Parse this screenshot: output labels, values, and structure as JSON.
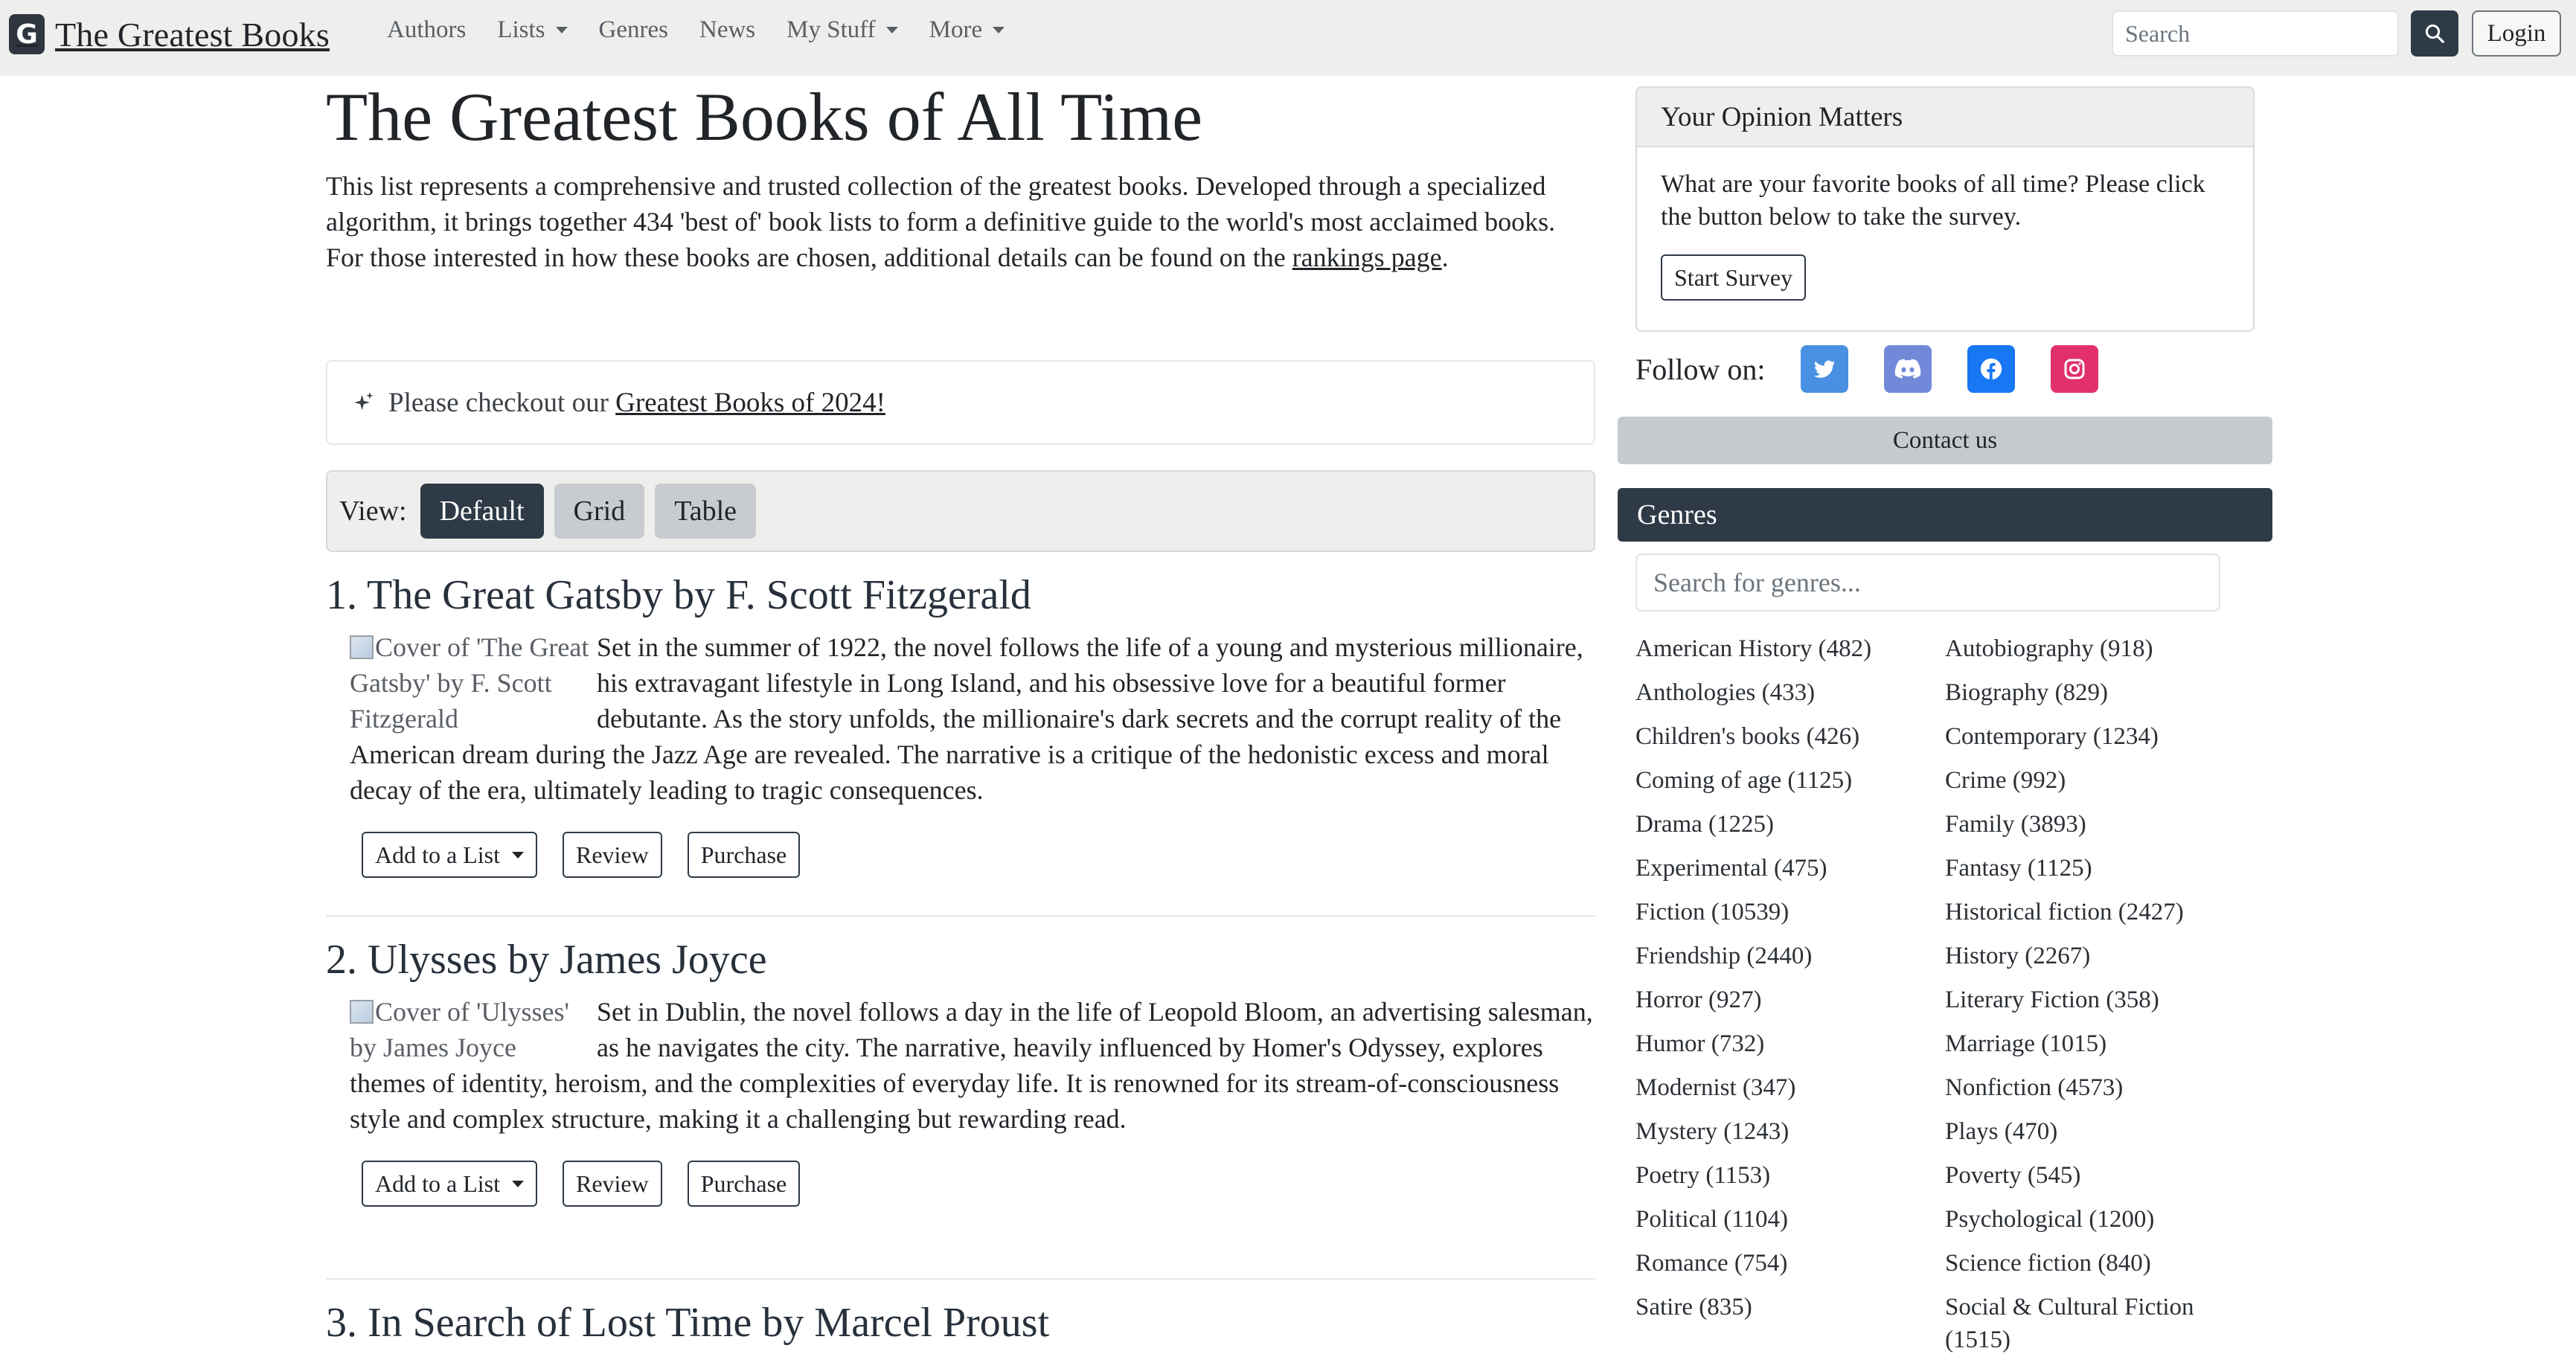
{
  "nav": {
    "brand": "The Greatest Books",
    "logo_letter": "G",
    "links": [
      {
        "label": "Authors",
        "dropdown": false
      },
      {
        "label": "Lists",
        "dropdown": true
      },
      {
        "label": "Genres",
        "dropdown": false
      },
      {
        "label": "News",
        "dropdown": false
      },
      {
        "label": "My Stuff",
        "dropdown": true
      },
      {
        "label": "More",
        "dropdown": true
      }
    ],
    "search_placeholder": "Search",
    "login_label": "Login"
  },
  "main": {
    "title": "The Greatest Books of All Time",
    "intro_text": "This list represents a comprehensive and trusted collection of the greatest books. Developed through a specialized algorithm, it brings together 434 'best of' book lists to form a definitive guide to the world's most acclaimed books. For those interested in how these books are chosen, additional details can be found on the ",
    "intro_link": "rankings page",
    "intro_end": ".",
    "notice_text": "Please checkout our ",
    "notice_link": "Greatest Books of 2024!",
    "view_label": "View:",
    "views": [
      "Default",
      "Grid",
      "Table"
    ],
    "active_view": "Default",
    "books": [
      {
        "title": "1. The Great Gatsby by F. Scott Fitzgerald",
        "cover_alt": "Cover of 'The Great Gatsby' by F. Scott Fitzgerald",
        "description": "Set in the summer of 1922, the novel follows the life of a young and mysterious millionaire, his extravagant lifestyle in Long Island, and his obsessive love for a beautiful former debutante. As the story unfolds, the millionaire's dark secrets and the corrupt reality of the American dream during the Jazz Age are revealed. The narrative is a critique of the hedonistic excess and moral decay of the era, ultimately leading to tragic consequences.",
        "actions": {
          "add": "Add to a List",
          "review": "Review",
          "purchase": "Purchase"
        }
      },
      {
        "title": "2. Ulysses by James Joyce",
        "cover_alt": "Cover of 'Ulysses' by James Joyce",
        "description": "Set in Dublin, the novel follows a day in the life of Leopold Bloom, an advertising salesman, as he navigates the city. The narrative, heavily influenced by Homer's Odyssey, explores themes of identity, heroism, and the complexities of everyday life. It is renowned for its stream-of-consciousness style and complex structure, making it a challenging but rewarding read.",
        "actions": {
          "add": "Add to a List",
          "review": "Review",
          "purchase": "Purchase"
        }
      },
      {
        "title": "3. In Search of Lost Time by Marcel Proust"
      }
    ]
  },
  "sidebar": {
    "opinion_title": "Your Opinion Matters",
    "opinion_text": "What are your favorite books of all time? Please click the button below to take the survey.",
    "survey_label": "Start Survey",
    "follow_label": "Follow on:",
    "social": [
      {
        "name": "twitter-icon",
        "color": "#4a90e2"
      },
      {
        "name": "discord-icon",
        "color": "#7289da"
      },
      {
        "name": "facebook-icon",
        "color": "#1877f2"
      },
      {
        "name": "instagram-icon",
        "color": "#e1306c"
      }
    ],
    "contact_label": "Contact us",
    "genres_title": "Genres",
    "genre_search_placeholder": "Search for genres...",
    "genres": [
      "American History (482)",
      "Autobiography (918)",
      "Anthologies (433)",
      "Biography (829)",
      "Children's books (426)",
      "Contemporary (1234)",
      "Coming of age (1125)",
      "Crime (992)",
      "Drama (1225)",
      "Family (3893)",
      "Experimental (475)",
      "Fantasy (1125)",
      "Fiction (10539)",
      "Historical fiction (2427)",
      "Friendship (2440)",
      "History (2267)",
      "Horror (927)",
      "Literary Fiction (358)",
      "Humor (732)",
      "Marriage (1015)",
      "Modernist (347)",
      "Nonfiction (4573)",
      "Mystery (1243)",
      "Plays (470)",
      "Poetry (1153)",
      "Poverty (545)",
      "Political (1104)",
      "Psychological (1200)",
      "Romance (754)",
      "Science fiction (840)",
      "Satire (835)",
      "Social & Cultural Fiction (1515)"
    ]
  },
  "colors": {
    "navbar_bg": "#eeefec",
    "dark_accent": "#2f3a47"
  }
}
